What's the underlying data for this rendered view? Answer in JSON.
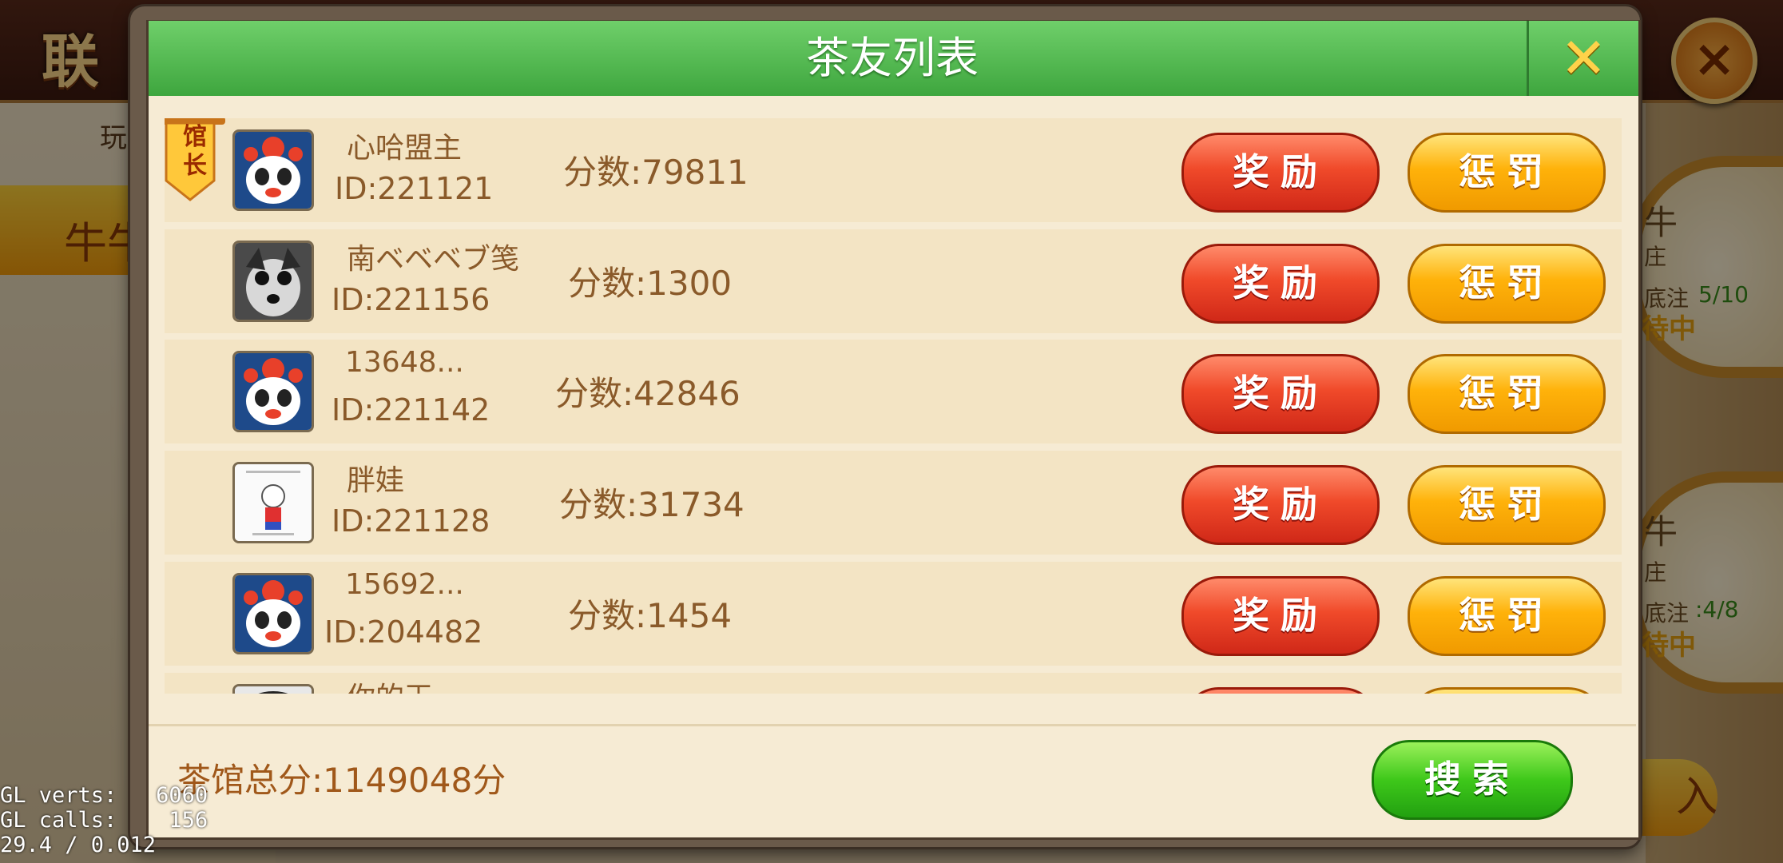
{
  "background": {
    "logo_text": "联",
    "left_label": "玩",
    "left_tab": "牛牛",
    "tables": [
      {
        "top_char": "牛",
        "banker": "庄",
        "bet_label": "底注",
        "bet_value": "5/10",
        "status": "待中"
      },
      {
        "top_char": "牛",
        "banker": "庄",
        "bet_label": "底注",
        "bet_value": ":4/8",
        "status": "待中"
      }
    ],
    "close_icon": "×",
    "join_label": "入"
  },
  "debug": {
    "line1": "GL verts:   6060",
    "line2": "GL calls:    156",
    "line3": "29.4 / 0.012"
  },
  "dialog": {
    "title": "茶友列表",
    "close_icon": "✕"
  },
  "members": [
    {
      "name": "心哈盟主",
      "id": "ID:221121",
      "score": "分数:79811",
      "owner": true,
      "avatar": "panda-opera-avatar"
    },
    {
      "name": "南ベベベブ笺",
      "id": "ID:221156",
      "score": "分数:1300",
      "owner": false,
      "avatar": "husky-dog-avatar"
    },
    {
      "name": "13648...",
      "id": "ID:221142",
      "score": "分数:42846",
      "owner": false,
      "avatar": "panda-opera-avatar"
    },
    {
      "name": "胖娃",
      "id": "ID:221128",
      "score": "分数:31734",
      "owner": false,
      "avatar": "cartoon-sticker-avatar"
    },
    {
      "name": "15692...",
      "id": "ID:204482",
      "score": "分数:1454",
      "owner": false,
      "avatar": "panda-opera-avatar"
    },
    {
      "name": "你的王",
      "id": "",
      "score": "",
      "owner": false,
      "avatar": "dark-photo-avatar"
    }
  ],
  "owner_badge": "馆长",
  "buttons": {
    "reward": "奖励",
    "punish": "惩罚",
    "search": "搜索"
  },
  "footer": {
    "total": "茶馆总分:1149048分"
  }
}
